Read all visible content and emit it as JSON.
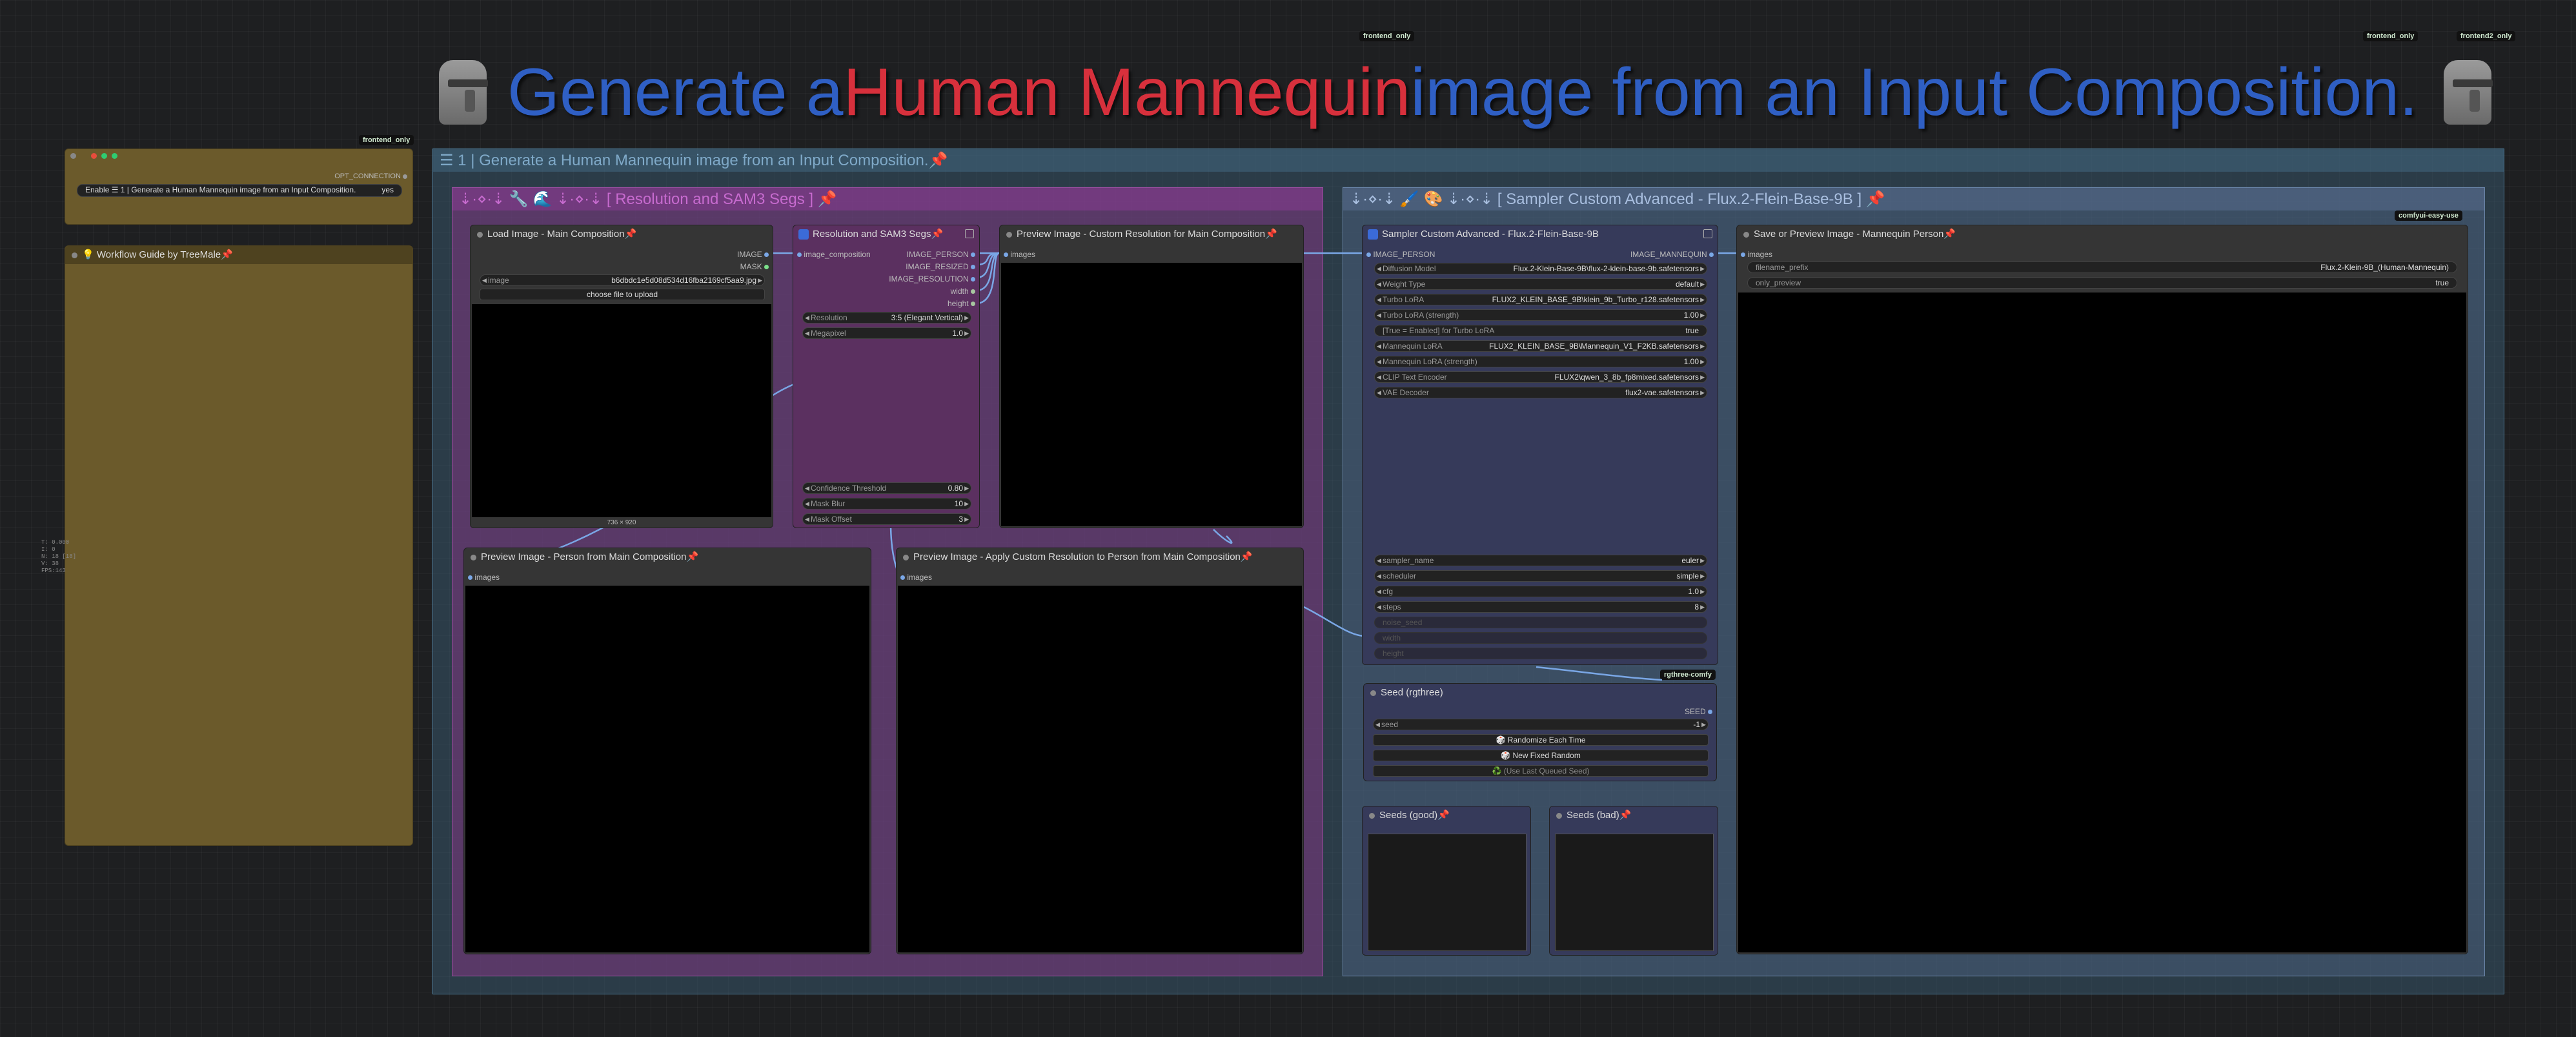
{
  "badges": {
    "top_center": "frontend_only",
    "top_right_1": "frontend_only",
    "top_right_2": "frontend2_only",
    "left_panel": "frontend_only",
    "easy_use": "comfyui-easy-use",
    "rgthree": "rgthree-comfy"
  },
  "banner": {
    "part1": "Generate a ",
    "part2": "Human Mannequin",
    "part3": " image from an Input Composition."
  },
  "toggle_node": {
    "output": "OPT_CONNECTION",
    "label": "Enable ☰ 1 | Generate a Human Mannequin image from an Input Composition.",
    "value": "yes"
  },
  "guide_node": {
    "title": "💡 Workflow Guide by TreeMale📌"
  },
  "stats": [
    "T: 0.000",
    "I: 0",
    "N: 18 [18]",
    "V: 38",
    "FPS:143"
  ],
  "main_group": {
    "title": "☰ 1 | Generate a Human Mannequin image from an Input Composition.📌"
  },
  "resolution_group": {
    "title": "⇣·⋄·⇣ 🔧 🌊 ⇣·⋄·⇣ [ Resolution and SAM3 Segs ] 📌"
  },
  "sampler_group": {
    "title": "⇣·⋄·⇣ 🖌️ 🎨 ⇣·⋄·⇣ [ Sampler Custom Advanced - Flux.2-Flein-Base-9B ] 📌"
  },
  "load_image": {
    "title": "Load Image - Main Composition📌",
    "out1": "IMAGE",
    "out2": "MASK",
    "image_label": "image",
    "image_value": "b6dbdc1e5d08d534d16fba2169cf5aa9.jpg",
    "upload": "choose file to upload",
    "size": "736 × 920"
  },
  "res_node": {
    "title": "Resolution and SAM3 Segs📌",
    "input": "image_composition",
    "out1": "IMAGE_PERSON",
    "out2": "IMAGE_RESIZED",
    "out3": "IMAGE_RESOLUTION",
    "out4": "width",
    "out5": "height",
    "w1_label": "Resolution",
    "w1_value": "3:5 (Elegant Vertical)",
    "w2_label": "Megapixel",
    "w2_value": "1.0",
    "w3_label": "Confidence Threshold",
    "w3_value": "0.80",
    "w4_label": "Mask Blur",
    "w4_value": "10",
    "w5_label": "Mask Offset",
    "w5_value": "3"
  },
  "preview_custom": {
    "title": "Preview Image - Custom Resolution for Main Composition📌",
    "input": "images"
  },
  "preview_person": {
    "title": "Preview Image - Person from Main Composition📌",
    "input": "images"
  },
  "preview_apply": {
    "title": "Preview Image - Apply Custom Resolution to Person from Main Composition📌",
    "input": "images"
  },
  "sampler": {
    "title": "Sampler Custom Advanced - Flux.2-Flein-Base-9B",
    "input": "IMAGE_PERSON",
    "output": "IMAGE_MANNEQUIN",
    "rows": [
      {
        "label": "Diffusion Model",
        "value": "Flux.2-Klein-Base-9B\\flux-2-klein-base-9b.safetensors"
      },
      {
        "label": "Weight Type",
        "value": "default"
      },
      {
        "label": "Turbo LoRA",
        "value": "FLUX2_KLEIN_BASE_9B\\klein_9b_Turbo_r128.safetensors"
      },
      {
        "label": "Turbo LoRA (strength)",
        "value": "1.00"
      },
      {
        "label": "[True = Enabled] for Turbo LoRA",
        "value": "true"
      },
      {
        "label": "Mannequin LoRA",
        "value": "FLUX2_KLEIN_BASE_9B\\Mannequin_V1_F2KB.safetensors"
      },
      {
        "label": "Mannequin LoRA (strength)",
        "value": "1.00"
      },
      {
        "label": "CLIP Text Encoder",
        "value": "FLUX2\\qwen_3_8b_fp8mixed.safetensors"
      },
      {
        "label": "VAE Decoder",
        "value": "flux2-vae.safetensors"
      }
    ],
    "rows2": [
      {
        "label": "sampler_name",
        "value": "euler"
      },
      {
        "label": "scheduler",
        "value": "simple"
      },
      {
        "label": "cfg",
        "value": "1.0"
      },
      {
        "label": "steps",
        "value": "8"
      }
    ],
    "dim1": "noise_seed",
    "dim2": "width",
    "dim3": "height"
  },
  "seed": {
    "title": "Seed (rgthree)",
    "output": "SEED",
    "label": "seed",
    "value": "-1",
    "b1": "🎲 Randomize Each Time",
    "b2": "🎲 New Fixed Random",
    "b3": "♻️ (Use Last Queued Seed)"
  },
  "seeds_good": {
    "title": "Seeds (good)📌"
  },
  "seeds_bad": {
    "title": "Seeds (bad)📌"
  },
  "save": {
    "title": "Save or Preview Image - Mannequin Person📌",
    "input": "images",
    "w1_label": "filename_prefix",
    "w1_value": "Flux.2-Klein-9B_(Human-Mannequin)",
    "w2_label": "only_preview",
    "w2_value": "true"
  }
}
